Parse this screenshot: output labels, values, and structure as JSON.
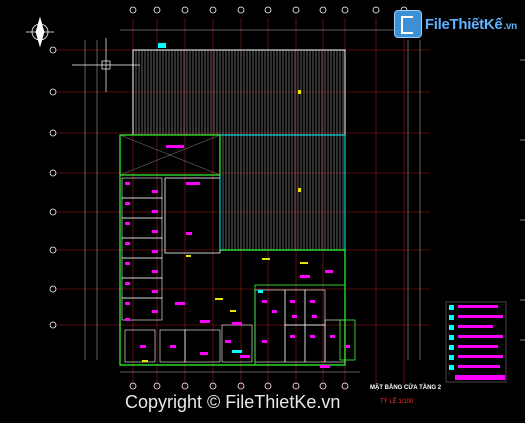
{
  "watermark": {
    "brand_part1": "File",
    "brand_part2": "Thiết",
    "brand_part3": "Kế",
    "brand_domain": ".vn",
    "copyright": "Copyright © FileThietKe.vn"
  },
  "drawing": {
    "sheet_title": "MẶT BẰNG CỬA TẦNG 2",
    "sheet_subtitle": "TỶ LỆ 1/100"
  },
  "colors": {
    "background": "#000000",
    "grid_line": "#b22222",
    "axis_bubble": "#ffffff",
    "wall": "#ffffff",
    "room_outline": "#33ff33",
    "roof_outline": "#00ffff",
    "door_tag": "#ff00ff",
    "dimension": "#ff3030"
  },
  "axis_marks": {
    "top_count": 12,
    "left_count": 8
  }
}
